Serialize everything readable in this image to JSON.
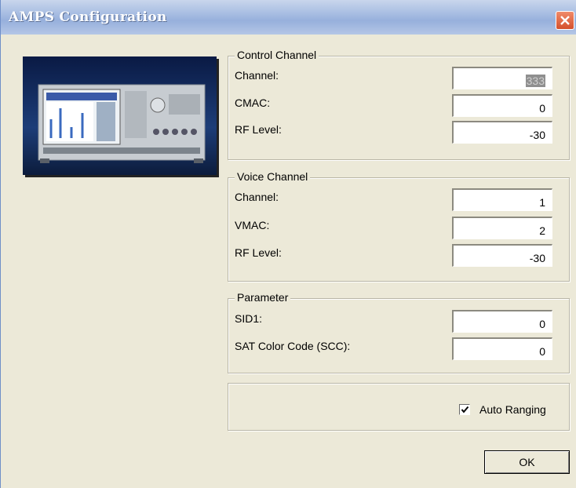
{
  "window": {
    "title": "AMPS Configuration"
  },
  "control_channel": {
    "legend": "Control Channel",
    "channel_label": "Channel:",
    "channel_value": "333",
    "cmac_label": "CMAC:",
    "cmac_value": "0",
    "rf_label": "RF Level:",
    "rf_value": "-30"
  },
  "voice_channel": {
    "legend": "Voice Channel",
    "channel_label": "Channel:",
    "channel_value": "1",
    "vmac_label": "VMAC:",
    "vmac_value": "2",
    "rf_label": "RF Level:",
    "rf_value": "-30"
  },
  "parameter": {
    "legend": "Parameter",
    "sid_label": "SID1:",
    "sid_value": "0",
    "scc_label": "SAT Color Code (SCC):",
    "scc_value": "0"
  },
  "options": {
    "auto_ranging_label": "Auto Ranging",
    "auto_ranging_checked": true
  },
  "buttons": {
    "ok_label": "OK"
  },
  "colors": {
    "title_bar": "#a7bde2",
    "dialog_bg": "#ece9d8",
    "close": "#d4502c"
  }
}
